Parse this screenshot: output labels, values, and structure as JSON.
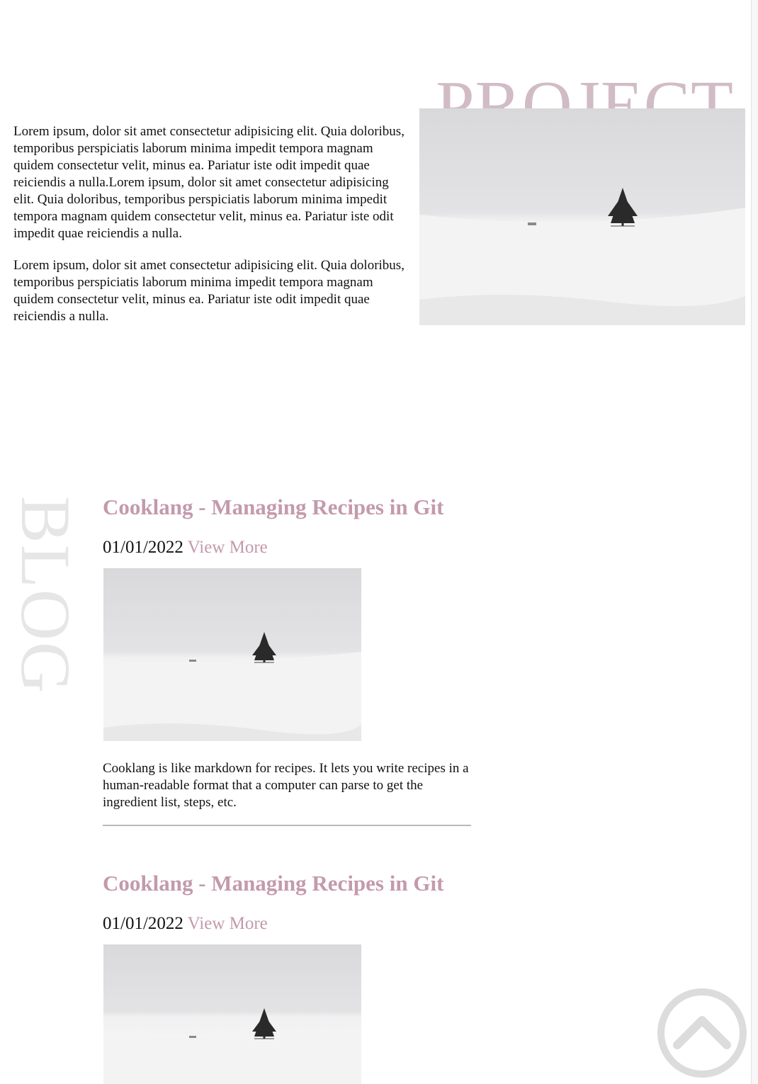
{
  "project": {
    "title": "PROJECT",
    "paragraphs": [
      "Lorem ipsum, dolor sit amet consectetur adipisicing elit. Quia doloribus, temporibus perspiciatis laborum minima impedit tempora magnam quidem consectetur velit, minus ea. Pariatur iste odit impedit quae reiciendis a nulla.Lorem ipsum, dolor sit amet consectetur adipisicing elit. Quia doloribus, temporibus perspiciatis laborum minima impedit tempora magnam quidem consectetur velit, minus ea. Pariatur iste odit impedit quae reiciendis a nulla.",
      "Lorem ipsum, dolor sit amet consectetur adipisicing elit. Quia doloribus, temporibus perspiciatis laborum minima impedit tempora magnam quidem consectetur velit, minus ea. Pariatur iste odit impedit quae reiciendis a nulla."
    ]
  },
  "blog": {
    "section_label": "BLOG",
    "posts": [
      {
        "title": "Cooklang - Managing Recipes in Git",
        "date": "01/01/2022",
        "link_label": "View More",
        "excerpt": "Cooklang is like markdown for recipes. It lets you write recipes in a human-readable format that a computer can parse to get the ingredient list, steps, etc."
      },
      {
        "title": "Cooklang - Managing Recipes in Git",
        "date": "01/01/2022",
        "link_label": "View More"
      }
    ]
  },
  "icons": {
    "scroll_top": "chevron-up-circle-icon"
  },
  "colors": {
    "accent": "#c39aac",
    "project_title": "#d1bcc6",
    "blog_label": "#e6e6e6"
  }
}
